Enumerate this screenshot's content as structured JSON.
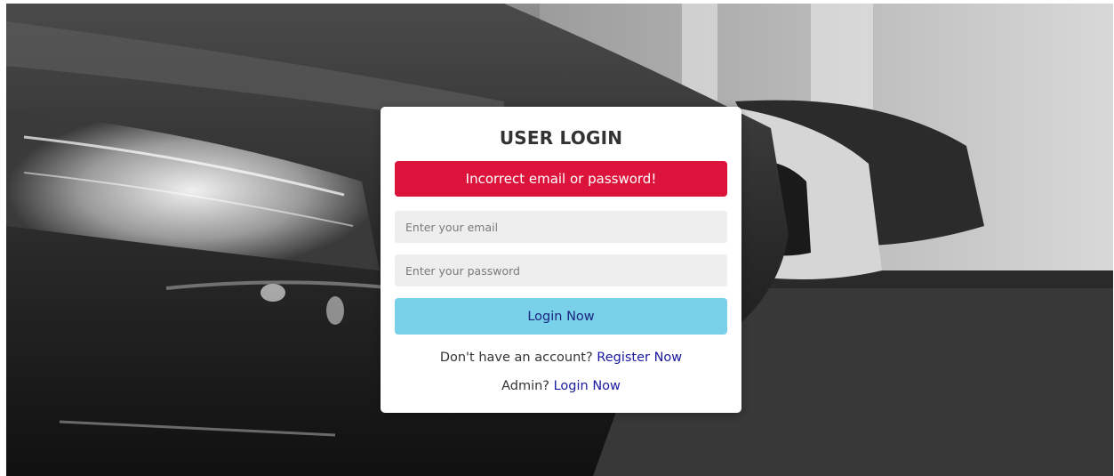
{
  "login": {
    "title": "USER LOGIN",
    "error_message": "Incorrect email or password!",
    "email_placeholder": "Enter your email",
    "password_placeholder": "Enter your password",
    "submit_label": "Login Now",
    "register_prompt": "Don't have an account?",
    "register_link": "Register Now",
    "admin_prompt": "Admin?",
    "admin_link": "Login Now"
  },
  "colors": {
    "error_bg": "#dc143c",
    "button_bg": "#79d0e9",
    "link": "#1a1a9e"
  }
}
